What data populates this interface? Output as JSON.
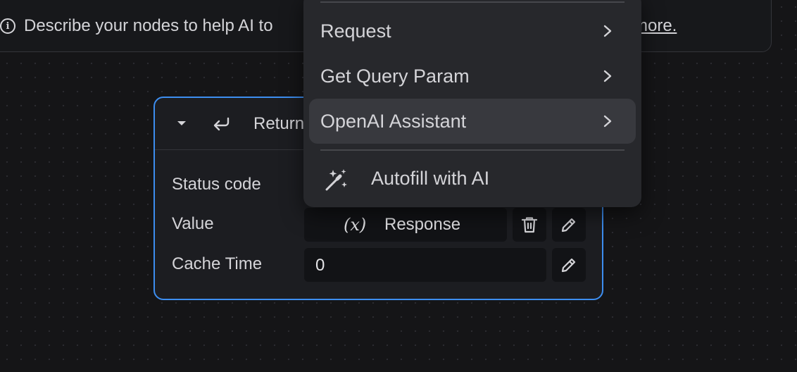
{
  "banner": {
    "text": "Describe your nodes to help AI to",
    "link_text": "more."
  },
  "node": {
    "title": "Return",
    "rows": [
      {
        "label": "Status code"
      },
      {
        "label": "Value",
        "value": "Response",
        "var_symbol": "(x)"
      },
      {
        "label": "Cache Time",
        "value": "0"
      }
    ]
  },
  "menu": {
    "items": [
      {
        "label": "Request"
      },
      {
        "label": "Get Query Param"
      },
      {
        "label": "OpenAI Assistant"
      }
    ],
    "autofill_label": "Autofill with AI"
  },
  "colors": {
    "accent_border": "#3d8ef0",
    "canvas_bg": "#151517",
    "menu_bg": "#27282c"
  }
}
